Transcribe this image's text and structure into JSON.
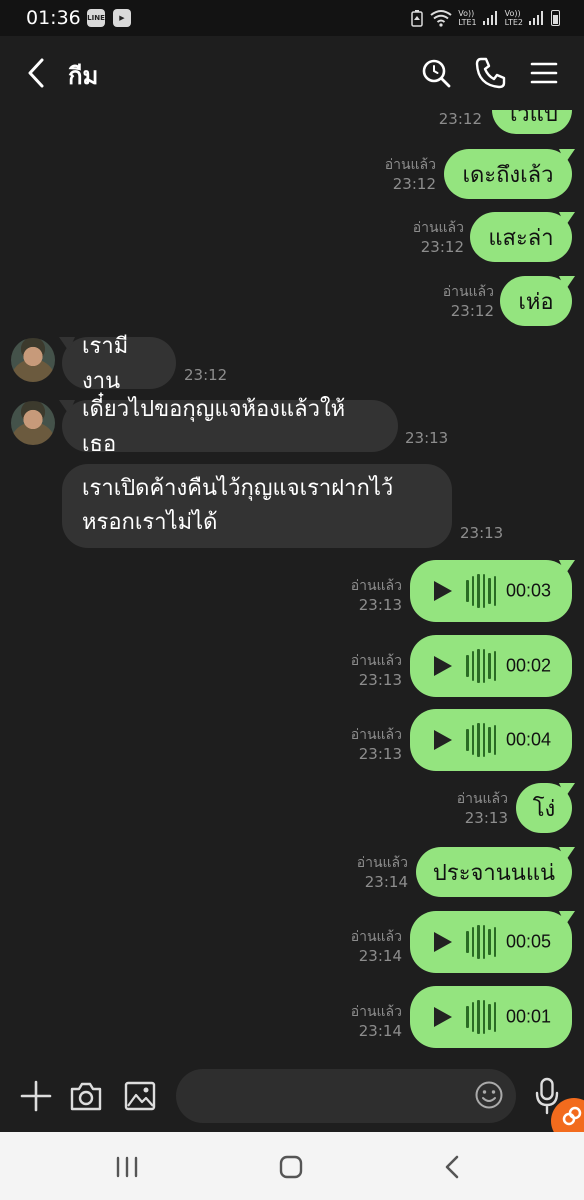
{
  "status_bar": {
    "time": "01:36",
    "net1": "Vo))",
    "net1_sub": "LTE1",
    "net2": "Vo))",
    "net2_sub": "LTE2",
    "icons": [
      "line-app-icon",
      "youtube-like-icon",
      "battery-saver-icon",
      "wifi-icon",
      "signal-icon",
      "battery-icon"
    ]
  },
  "header": {
    "title": "กีม",
    "icons": [
      "back-arrow-icon",
      "search-icon",
      "phone-icon",
      "menu-icon"
    ]
  },
  "messages": [
    {
      "dir": "out",
      "text": "ไวแป",
      "time": "23:12",
      "read": ""
    },
    {
      "dir": "out",
      "text": "เดะถึงเล้ว",
      "time": "23:12",
      "read": "อ่านแล้ว"
    },
    {
      "dir": "out",
      "text": "แสะล่า",
      "time": "23:12",
      "read": "อ่านแล้ว"
    },
    {
      "dir": "out",
      "text": "เห่อ",
      "time": "23:12",
      "read": "อ่านแล้ว"
    },
    {
      "dir": "in",
      "text": "เรามีงาน",
      "time": "23:12"
    },
    {
      "dir": "in",
      "text": "เดี๋ยวไปขอกุญแจห้องแล้วให้เธอ",
      "time": "23:13"
    },
    {
      "dir": "in",
      "text_line1": "เราเปิดค้างคืนไว้กุญแจเราฝากไว้",
      "text_line2": "หรอกเราไม่ได้",
      "time": "23:13"
    },
    {
      "dir": "out",
      "type": "voice",
      "duration": "00:03",
      "time": "23:13",
      "read": "อ่านแล้ว"
    },
    {
      "dir": "out",
      "type": "voice",
      "duration": "00:02",
      "time": "23:13",
      "read": "อ่านแล้ว"
    },
    {
      "dir": "out",
      "type": "voice",
      "duration": "00:04",
      "time": "23:13",
      "read": "อ่านแล้ว"
    },
    {
      "dir": "out",
      "text": "โง่",
      "time": "23:13",
      "read": "อ่านแล้ว"
    },
    {
      "dir": "out",
      "text": "ประจานนแน่",
      "time": "23:14",
      "read": "อ่านแล้ว"
    },
    {
      "dir": "out",
      "type": "voice",
      "duration": "00:05",
      "time": "23:14",
      "read": "อ่านแล้ว"
    },
    {
      "dir": "out",
      "type": "voice",
      "duration": "00:01",
      "time": "23:14",
      "read": "อ่านแล้ว"
    }
  ],
  "composer": {
    "icons": [
      "plus-icon",
      "camera-icon",
      "image-icon",
      "emoji-icon",
      "mic-icon"
    ],
    "placeholder": ""
  },
  "colors": {
    "outgoing_bubble": "#94e47f",
    "incoming_bubble": "#333333",
    "background": "#1e1e1e",
    "badge": "#f26b1d"
  }
}
